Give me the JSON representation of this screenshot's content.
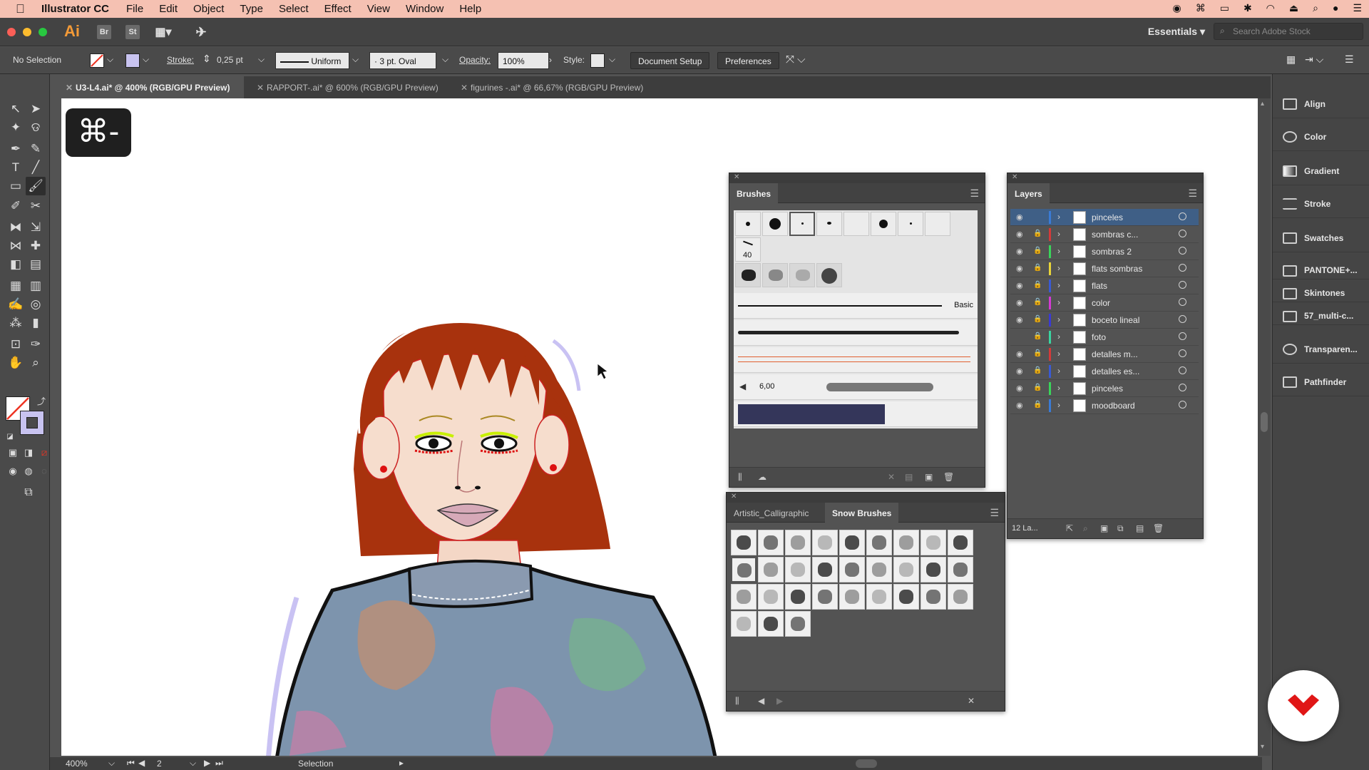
{
  "menubar": {
    "app_name": "Illustrator CC",
    "menus": [
      "File",
      "Edit",
      "Object",
      "Type",
      "Select",
      "Effect",
      "View",
      "Window",
      "Help"
    ]
  },
  "appbar": {
    "logo": "Ai",
    "bridge": "Br",
    "stock": "St",
    "workspace": "Essentials",
    "search_placeholder": "Search Adobe Stock"
  },
  "controlbar": {
    "selection": "No Selection",
    "stroke_label": "Stroke:",
    "stroke_value": "0,25 pt",
    "profile": "Uniform",
    "brush": "3 pt. Oval",
    "opacity_label": "Opacity:",
    "opacity_value": "100%",
    "style_label": "Style:",
    "document_setup": "Document Setup",
    "preferences": "Preferences"
  },
  "tabs": [
    {
      "label": "U3-L4.ai* @ 400% (RGB/GPU Preview)"
    },
    {
      "label": "RAPPORT-.ai* @ 600% (RGB/GPU Preview)"
    },
    {
      "label": "figurines -.ai* @ 66,67% (RGB/GPU Preview)"
    }
  ],
  "canvas": {
    "shortcut": "⌘-"
  },
  "brushes_panel": {
    "title": "Brushes",
    "size_label": "40",
    "basic_label": "Basic",
    "size_value": "6,00"
  },
  "snow_panel": {
    "tab1": "Artistic_Calligraphic",
    "tab2": "Snow Brushes"
  },
  "layers_panel": {
    "title": "Layers",
    "count": "12 La...",
    "layers": [
      {
        "name": "pinceles",
        "color": "#3a7bd5"
      },
      {
        "name": "sombras c...",
        "color": "#d43a3a"
      },
      {
        "name": "sombras 2",
        "color": "#3ad45a"
      },
      {
        "name": "flats sombras",
        "color": "#e8d43a"
      },
      {
        "name": "flats",
        "color": "#3a5ad4"
      },
      {
        "name": "color",
        "color": "#d43ad4"
      },
      {
        "name": "boceto lineal",
        "color": "#3a3ad4"
      },
      {
        "name": "foto",
        "color": "#3ad4a0"
      },
      {
        "name": "detalles m...",
        "color": "#d43a3a"
      },
      {
        "name": "detalles es...",
        "color": "#3a5ad4"
      },
      {
        "name": "pinceles",
        "color": "#3ad45a"
      },
      {
        "name": "moodboard",
        "color": "#3a7bd5"
      }
    ]
  },
  "dock": {
    "items": [
      "Align",
      "Color",
      "Gradient",
      "Stroke",
      "Swatches",
      "PANTONE+...",
      "Skintones",
      "57_multi-c...",
      "Transparen...",
      "Pathfinder"
    ]
  },
  "statusbar": {
    "zoom": "400%",
    "artboard": "2",
    "tool": "Selection"
  }
}
